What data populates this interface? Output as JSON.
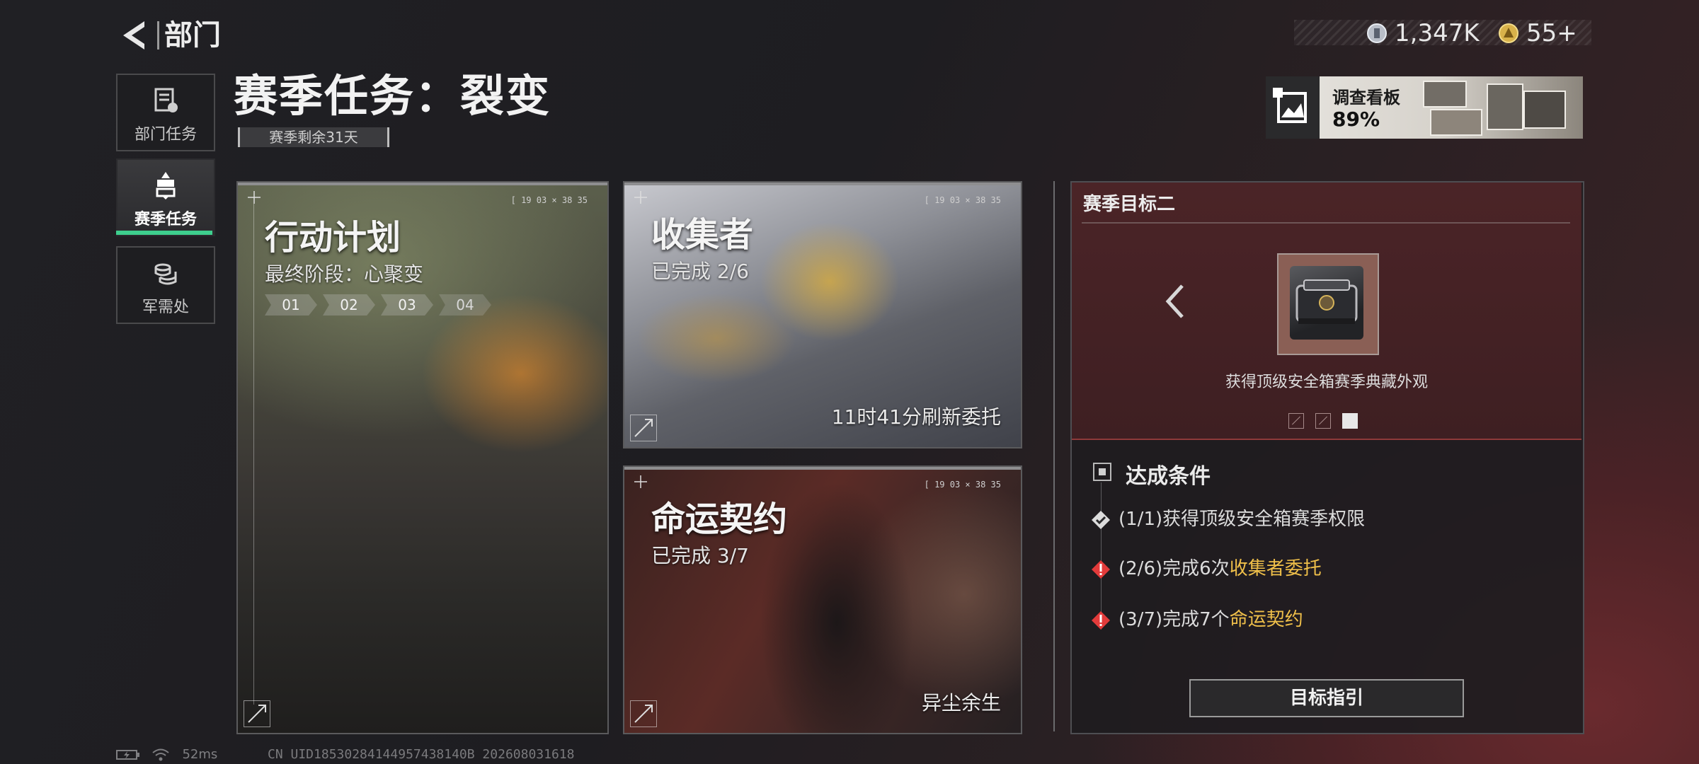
{
  "header": {
    "back_label": "部门",
    "currency1_value": "1,347K",
    "currency2_value": "55+"
  },
  "sidebar": {
    "items": [
      {
        "label": "部门任务"
      },
      {
        "label": "赛季任务"
      },
      {
        "label": "军需处"
      }
    ]
  },
  "page": {
    "title": "赛季任务：裂变",
    "days_left": "赛季剩余31天"
  },
  "board": {
    "label": "调查看板",
    "progress_text": "89%",
    "progress": 0.89
  },
  "cards": {
    "plan": {
      "title": "行动计划",
      "sub": "最终阶段：心聚变",
      "stages": [
        "01",
        "02",
        "03",
        "04"
      ],
      "stamp": "[ 19 03 × 38 35"
    },
    "collect": {
      "title": "收集者",
      "sub": "已完成 2/6",
      "footer": "11时41分刷新委托",
      "stamp": "[ 19 03 × 38 35"
    },
    "fate": {
      "title": "命运契约",
      "sub": "已完成 3/7",
      "footer": "异尘余生",
      "stamp": "[ 19 03 × 38 35"
    }
  },
  "goal": {
    "title": "赛季目标二",
    "reward_text": "获得顶级安全箱赛季典藏外观",
    "page_current": 3,
    "page_total": 3
  },
  "conditions": {
    "heading": "达成条件",
    "items": [
      {
        "status": "done",
        "prefix": "(1/1)获得顶级安全箱赛季权限",
        "highlight": ""
      },
      {
        "status": "warn",
        "prefix": "(2/6)完成6次",
        "highlight": "收集者委托"
      },
      {
        "status": "warn",
        "prefix": "(3/7)完成7个",
        "highlight": "命运契约"
      }
    ],
    "button_label": "目标指引"
  },
  "footer": {
    "ping": "52ms",
    "uid": "CN UID18530284144957438140B 202608031618"
  },
  "colors": {
    "accent_green": "#3ecf8e",
    "highlight_gold": "#f0c04a",
    "warn_red": "#e33b3b"
  }
}
